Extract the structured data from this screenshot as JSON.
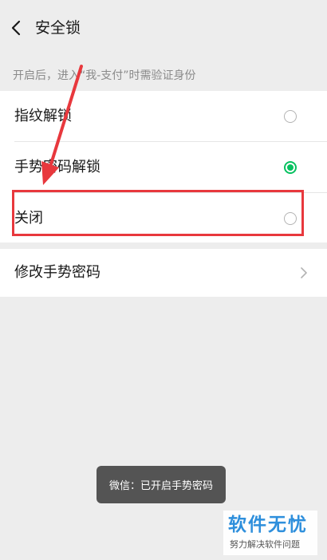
{
  "header": {
    "back_icon": "chevron-left-icon",
    "title": "安全锁"
  },
  "hint": "开启后，进入“我-支付”时需验证身份",
  "options": [
    {
      "label": "指纹解锁",
      "selected": false
    },
    {
      "label": "手势密码解锁",
      "selected": true
    },
    {
      "label": "关闭",
      "selected": false
    }
  ],
  "change_gesture": {
    "label": "修改手势密码",
    "icon": "chevron-right-icon"
  },
  "toast": "微信：已开启手势密码",
  "watermark": {
    "main": "软件无忧",
    "sub": "努力解决软件问题"
  },
  "colors": {
    "accent": "#07c160",
    "annotation": "#e8383d",
    "background": "#ededed",
    "watermark": "#2e8fdc"
  }
}
